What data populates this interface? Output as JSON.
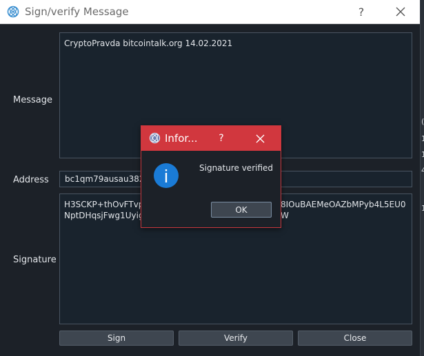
{
  "window": {
    "title": "Sign/verify Message",
    "help_glyph": "?"
  },
  "form": {
    "message_label": "Message",
    "message_value": "CryptoPravda  bitcointalk.org 14.02.2021",
    "address_label": "Address",
    "address_value": "bc1qm79ausau382t",
    "signature_label": "Signature",
    "signature_visible_start": "H3SCKP+thOvFTvpR",
    "signature_visible_end": "8IOuBAEMeOAZbMPyb4L5EU0W",
    "signature_line2": "NptDHqsjFwg1Uyig6"
  },
  "buttons": {
    "sign": "Sign",
    "verify": "Verify",
    "close": "Close"
  },
  "modal": {
    "title": "Infor...",
    "help_glyph": "?",
    "message": "Signature verified",
    "ok": "OK"
  },
  "background_glyphs": [
    "(",
    "1",
    "1",
    "4",
    "1"
  ],
  "colors": {
    "accent_red": "#d1373e",
    "info_blue": "#1a7bd6",
    "window_bg": "#1c2128"
  },
  "icons": {
    "app": "electrum-icon",
    "close": "close-icon",
    "info": "info-icon"
  }
}
